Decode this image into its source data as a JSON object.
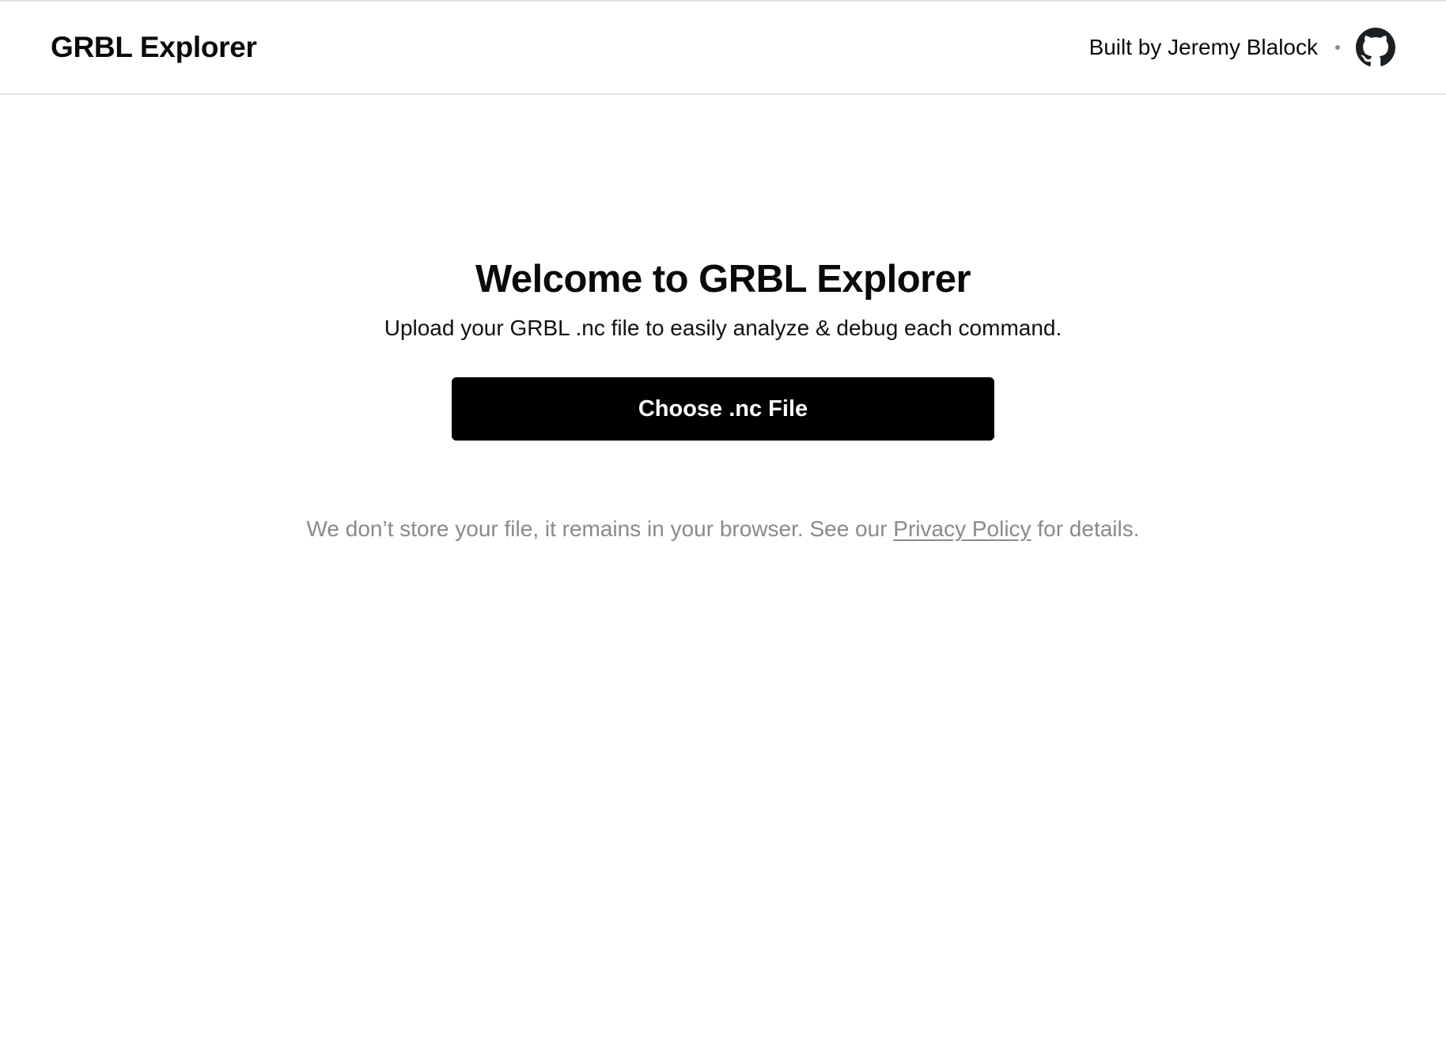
{
  "header": {
    "brand": "GRBL Explorer",
    "author_credit": "Built by Jeremy Blalock",
    "separator": "•",
    "github_icon": "github-icon"
  },
  "main": {
    "title": "Welcome to GRBL Explorer",
    "subtitle": "Upload your GRBL .nc file to easily analyze & debug each command.",
    "choose_button_label": "Choose .nc File",
    "privacy": {
      "before": "We don’t store your file, it remains in your browser. See our ",
      "link_label": "Privacy Policy",
      "after": " for details."
    }
  },
  "colors": {
    "text": "#0a0a0a",
    "muted": "#8a8a8a",
    "border": "#e4e4e4",
    "button_bg": "#000000",
    "button_text": "#ffffff"
  }
}
